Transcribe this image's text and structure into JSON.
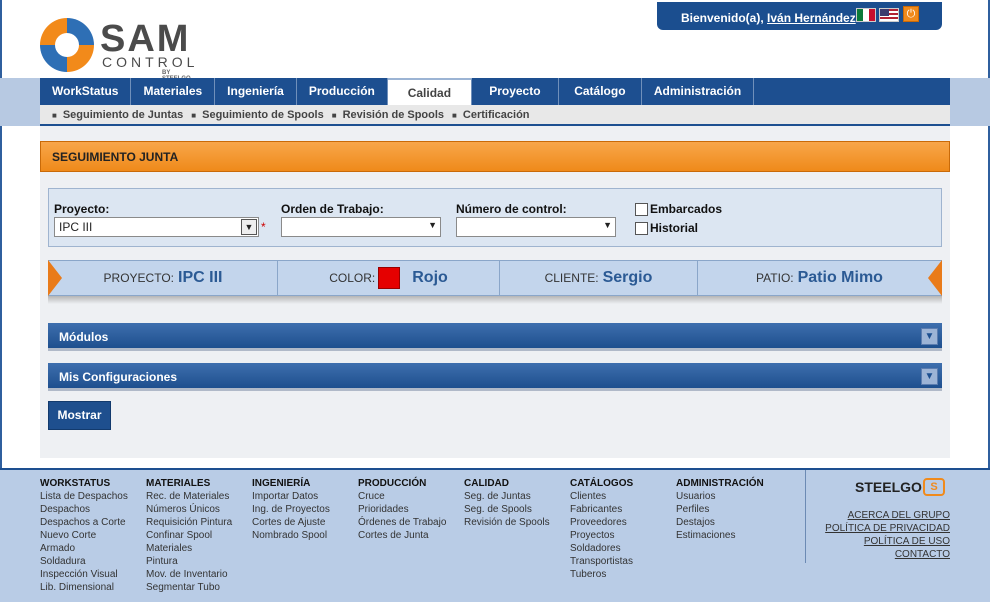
{
  "header": {
    "welcome_prefix": "Bienvenido(a),",
    "user_name": "Iván Hernández",
    "logo_main": "SAM",
    "logo_sub": "CONTROL",
    "logo_by": "BY STEELGO"
  },
  "nav": {
    "tabs": [
      "WorkStatus",
      "Materiales",
      "Ingeniería",
      "Producción",
      "Calidad",
      "Proyecto",
      "Catálogo",
      "Administración"
    ],
    "active_tab": "Calidad",
    "subitems": [
      "Seguimiento de Juntas",
      "Seguimiento de Spools",
      "Revisión de Spools",
      "Certificación"
    ]
  },
  "page": {
    "title": "SEGUIMIENTO JUNTA"
  },
  "filters": {
    "proyecto_label": "Proyecto:",
    "proyecto_value": "IPC III",
    "required_mark": "*",
    "orden_label": "Orden de Trabajo:",
    "orden_value": "",
    "numero_label": "Número de control:",
    "numero_value": "",
    "embarcados_label": "Embarcados",
    "historial_label": "Historial"
  },
  "info": {
    "proyecto_label": "PROYECTO:",
    "proyecto_value": "IPC III",
    "color_label": "COLOR:",
    "color_value": "Rojo",
    "color_hex": "#e50000",
    "cliente_label": "CLIENTE:",
    "cliente_value": "Sergio",
    "patio_label": "PATIO:",
    "patio_value": "Patio Mimo"
  },
  "accordions": {
    "modulos": "Módulos",
    "configuraciones": "Mis Configuraciones"
  },
  "buttons": {
    "mostrar": "Mostrar"
  },
  "footer": {
    "columns": [
      {
        "heading": "WORKSTATUS",
        "links": [
          "Lista de Despachos",
          "Despachos",
          "Despachos a Corte",
          "Nuevo Corte",
          "Armado",
          "Soldadura",
          "Inspección Visual",
          "Lib. Dimensional"
        ]
      },
      {
        "heading": "MATERIALES",
        "links": [
          "Rec. de Materiales",
          "Números Únicos",
          "Requisición Pintura",
          "Confinar Spool",
          "Materiales",
          "Pintura",
          "Mov. de Inventario",
          "Segmentar Tubo"
        ]
      },
      {
        "heading": "INGENIERÍA",
        "links": [
          "Importar Datos",
          "Ing. de Proyectos",
          "Cortes de Ajuste",
          "Nombrado Spool"
        ]
      },
      {
        "heading": "PRODUCCIÓN",
        "links": [
          "Cruce",
          "Prioridades",
          "Órdenes de Trabajo",
          "Cortes de Junta"
        ]
      },
      {
        "heading": "CALIDAD",
        "links": [
          "Seg. de Juntas",
          "Seg. de Spools",
          "Revisión de Spools"
        ]
      },
      {
        "heading": "CATÁLOGOS",
        "links": [
          "Clientes",
          "Fabricantes",
          "Proveedores",
          "Proyectos",
          "Soldadores",
          "Transportistas",
          "Tuberos"
        ]
      },
      {
        "heading": "ADMINISTRACIÓN",
        "links": [
          "Usuarios",
          "Perfiles",
          "Destajos",
          "Estimaciones"
        ]
      }
    ],
    "brand": "STEELGO",
    "right_links": [
      "ACERCA DEL GRUPO",
      "POLÍTICA DE PRIVACIDAD",
      "POLÍTICA DE USO",
      "CONTACTO"
    ]
  },
  "colors": {
    "nav_blue": "#1d4f90",
    "accent_orange": "#ef8a1a",
    "info_value_blue": "#2b5a94"
  }
}
